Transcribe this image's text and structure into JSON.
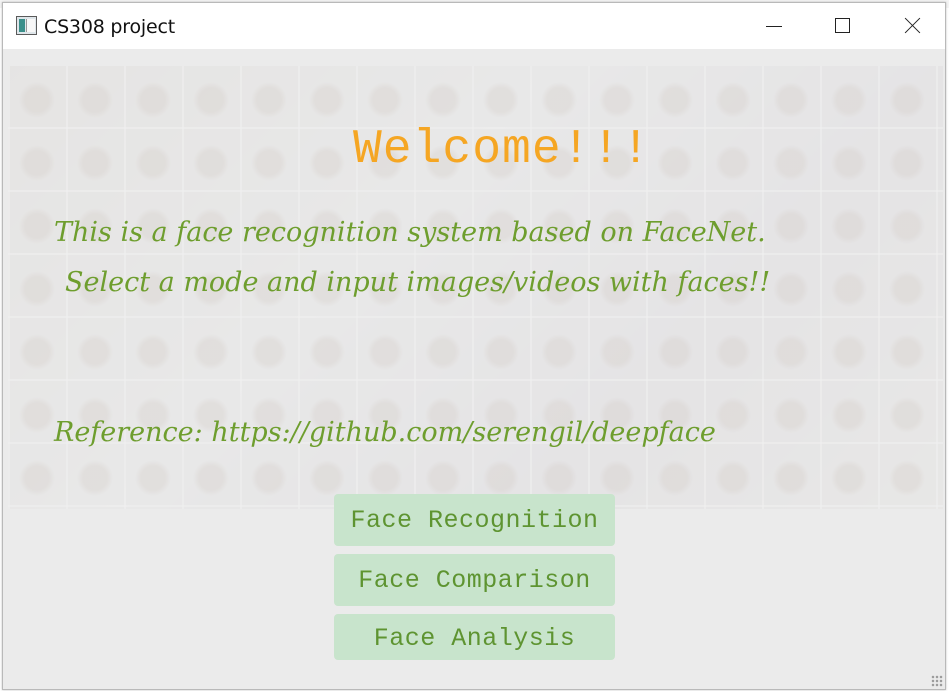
{
  "window": {
    "title": "CS308 project"
  },
  "main": {
    "welcome": "Welcome!!!",
    "description_line1": "This is a face recognition system based on FaceNet.",
    "description_line2": "Select a mode and input images/videos with faces!!",
    "reference": "Reference: https://github.com/serengil/deepface"
  },
  "modes": {
    "recognition_label": "Face Recognition",
    "comparison_label": "Face Comparison",
    "analysis_label": "Face Analysis"
  },
  "colors": {
    "welcome": "#f5a623",
    "text_green": "#6e9e2e",
    "button_bg": "#c8e4cc"
  },
  "icons": [
    "app-icon",
    "minimize-icon",
    "maximize-icon",
    "close-icon"
  ]
}
